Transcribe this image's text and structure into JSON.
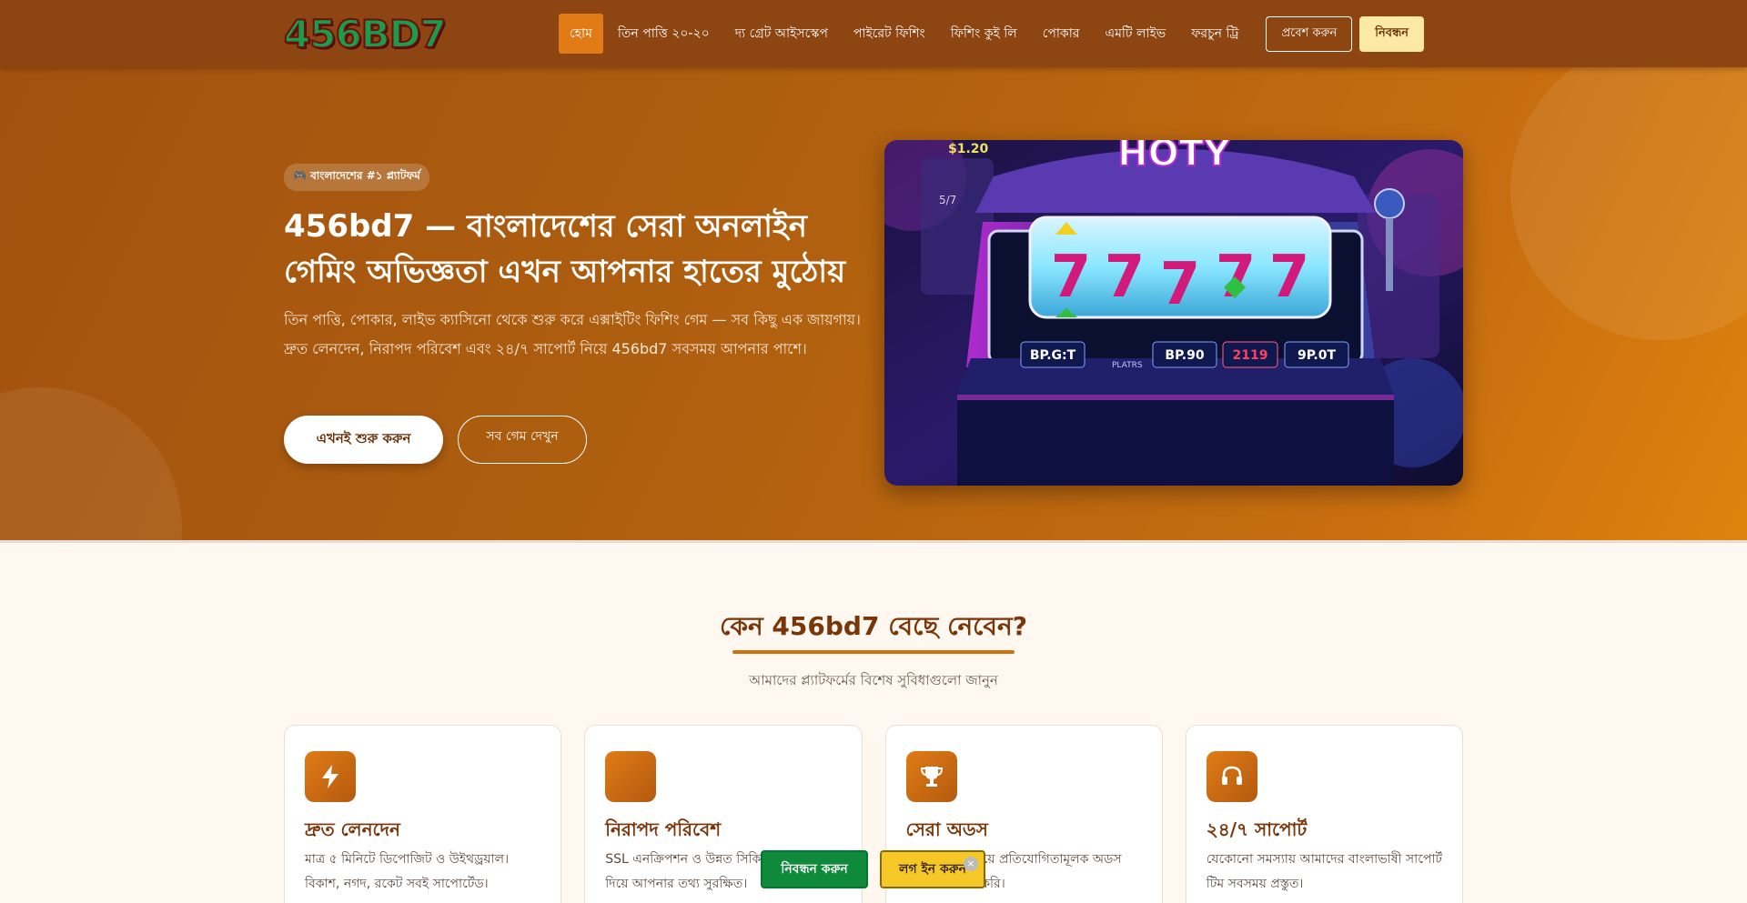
{
  "nav": {
    "logo": "456BD7",
    "menu": [
      "হোম",
      "তিন পাত্তি ২০-২০",
      "দ্য গ্রেট আইসস্কেপ",
      "পাইরেট ফিশিং",
      "ফিশিং কুই লি",
      "পোকার",
      "এমটি লাইভ",
      "ফরচুন ট্রি"
    ],
    "active_index": 0,
    "login_label": "প্রবেশ করুন",
    "register_label": "নিবন্ধন"
  },
  "hero": {
    "badge": "🎮 বাংলাদেশের #১ প্ল্যাটফর্ম",
    "title": "456bd7 — বাংলাদেশের সেরা অনলাইন গেমিং অভিজ্ঞতা এখন আপনার হাতের মুঠোয়",
    "description": "তিন পাত্তি, পোকার, লাইভ ক্যাসিনো থেকে শুরু করে এক্সাইটিং ফিশিং গেম — সব কিছু এক জায়গায়। দ্রুত লেনদেন, নিরাপদ পরিবেশ এবং ২৪/৭ সাপোর্ট নিয়ে 456bd7 সবসময় আপনার পাশে।",
    "cta_primary": "এখনই শুরু করুন",
    "cta_secondary": "সব গেম দেখুন",
    "image": {
      "sign_text": "HOTY",
      "top_numbers": [
        "$1.20",
        "5/7"
      ],
      "panel_labels": [
        "BP.G:T",
        "BP.90",
        "2119",
        "9P.0T"
      ],
      "panel_sub": "PLATRS"
    }
  },
  "features": {
    "title": "কেন 456bd7 বেছে নেবেন?",
    "subtitle": "আমাদের প্ল্যাটফর্মের বিশেষ সুবিধাগুলো জানুন",
    "cards": [
      {
        "icon": "lightning-icon",
        "title": "দ্রুত লেনদেন",
        "text": "মাত্র ৫ মিনিটে ডিপোজিট ও উইথড্রয়াল। বিকাশ, নগদ, রকেট সবই সাপোর্টেড।"
      },
      {
        "icon": "shield-icon",
        "title": "নিরাপদ পরিবেশ",
        "text": "SSL এনক্রিপশন ও উন্নত সিকিউরিটি সিস্টেম দিয়ে আপনার তথ্য সুরক্ষিত।"
      },
      {
        "icon": "trophy-icon",
        "title": "সেরা অডস",
        "text": "বাজারের সবচেয়ে প্রতিযোগিতামূলক অডস আমরা নিশ্চিত করি।"
      },
      {
        "icon": "headset-icon",
        "title": "২৪/৭ সাপোর্ট",
        "text": "যেকোনো সমস্যায় আমাদের বাংলাভাষী সাপোর্ট টিম সবসময় প্রস্তুত।"
      }
    ]
  },
  "floating": {
    "register_label": "নিবন্ধন করুন",
    "login_label": "লগ ইন করুন",
    "close_symbol": "×"
  }
}
